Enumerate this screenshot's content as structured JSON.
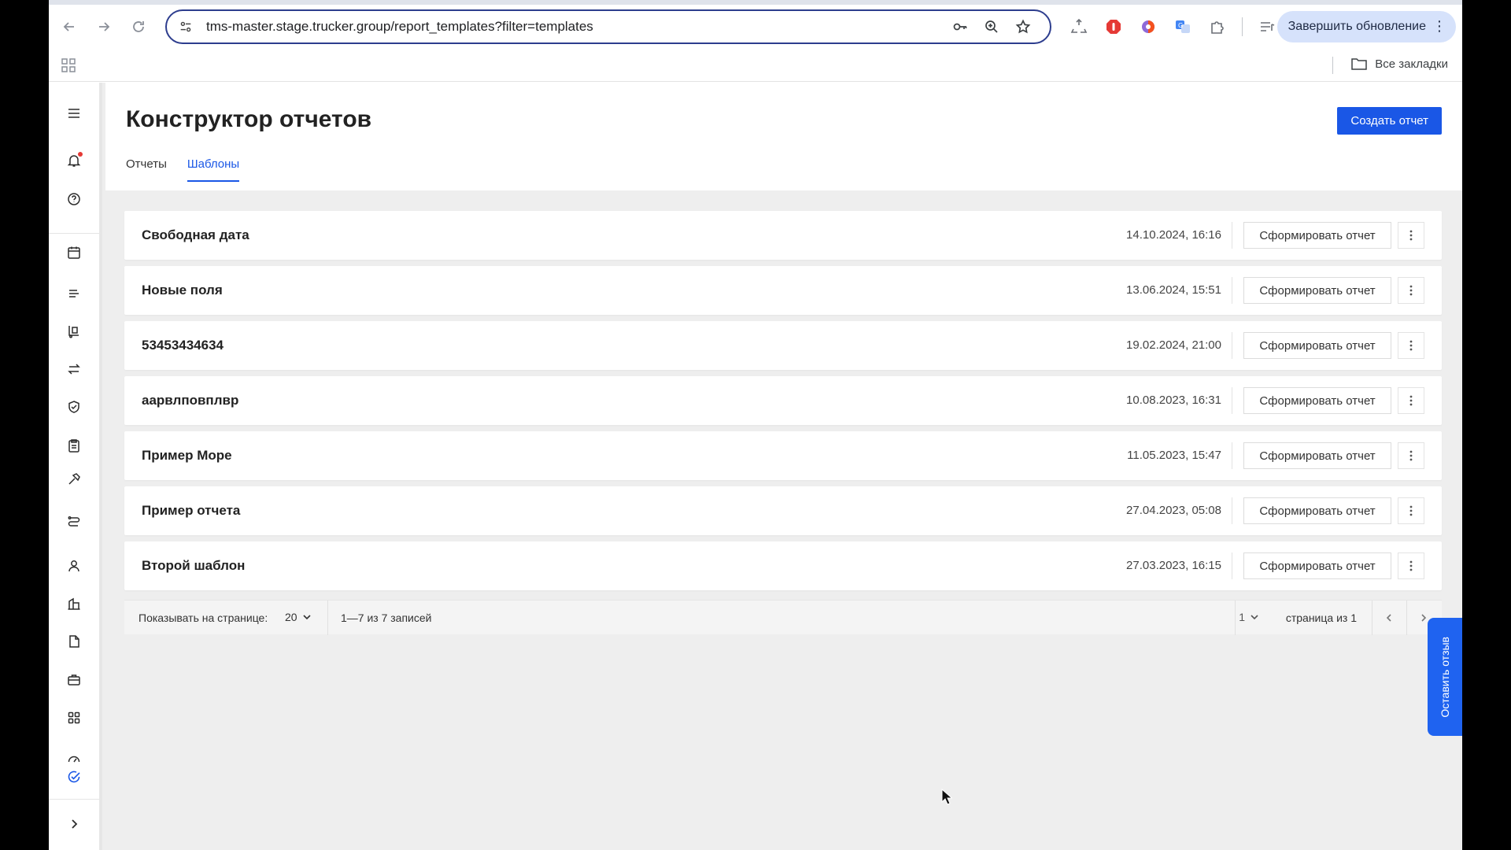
{
  "browser": {
    "url": "tms-master.stage.trucker.group/report_templates?filter=templates",
    "update_button": "Завершить обновление",
    "all_bookmarks": "Все закладки"
  },
  "page": {
    "title": "Конструктор отчетов",
    "create_button": "Создать отчет",
    "tabs": [
      {
        "label": "Отчеты",
        "active": false
      },
      {
        "label": "Шаблоны",
        "active": true
      }
    ]
  },
  "templates": [
    {
      "name": "Свободная дата",
      "date": "14.10.2024, 16:16",
      "action": "Сформировать отчет"
    },
    {
      "name": "Новые поля",
      "date": "13.06.2024, 15:51",
      "action": "Сформировать отчет"
    },
    {
      "name": "53453434634",
      "date": "19.02.2024, 21:00",
      "action": "Сформировать отчет"
    },
    {
      "name": "аарвлповплвр",
      "date": "10.08.2023, 16:31",
      "action": "Сформировать отчет"
    },
    {
      "name": "Пример Море",
      "date": "11.05.2023, 15:47",
      "action": "Сформировать отчет"
    },
    {
      "name": "Пример отчета",
      "date": "27.04.2023, 05:08",
      "action": "Сформировать отчет"
    },
    {
      "name": "Второй шаблон",
      "date": "27.03.2023, 16:15",
      "action": "Сформировать отчет"
    }
  ],
  "pagination": {
    "per_page_label": "Показывать на странице:",
    "per_page_value": "20",
    "range_text": "1—7 из 7 записей",
    "current_page": "1",
    "page_of_text": "страница из 1"
  },
  "feedback_tab": "Оставить отзыв",
  "colors": {
    "accent": "#1a57e6",
    "feedback": "#1f63f0",
    "background": "#eeeeee"
  }
}
